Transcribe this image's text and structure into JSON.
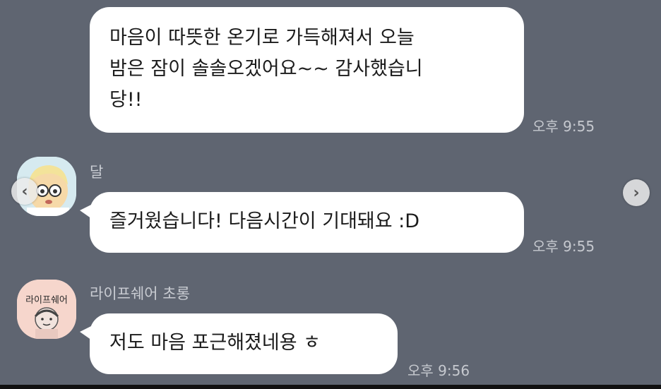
{
  "messages": [
    {
      "sender": "",
      "text_lines": [
        "마음이 따뜻한 온기로 가득해져서 오늘",
        "밤은 잠이 솔솔오겠어요~~ 감사했습니",
        "당!!"
      ],
      "time": "오후 9:55"
    },
    {
      "sender": "달",
      "text": "즐거웠습니다! 다음시간이 기대돼요 :D",
      "time": "오후 9:55"
    },
    {
      "sender": "라이프쉐어 초롱",
      "avatar_text": "라이프쉐어",
      "text": "저도 마음 포근해졌네용 ㅎ",
      "time": "오후 9:56"
    }
  ],
  "nav": {
    "prev_icon": "chevron-left-icon",
    "next_icon": "chevron-right-icon"
  },
  "colors": {
    "background": "#5f6571",
    "bubble": "#ffffff",
    "time_text": "#c6c9cf"
  }
}
